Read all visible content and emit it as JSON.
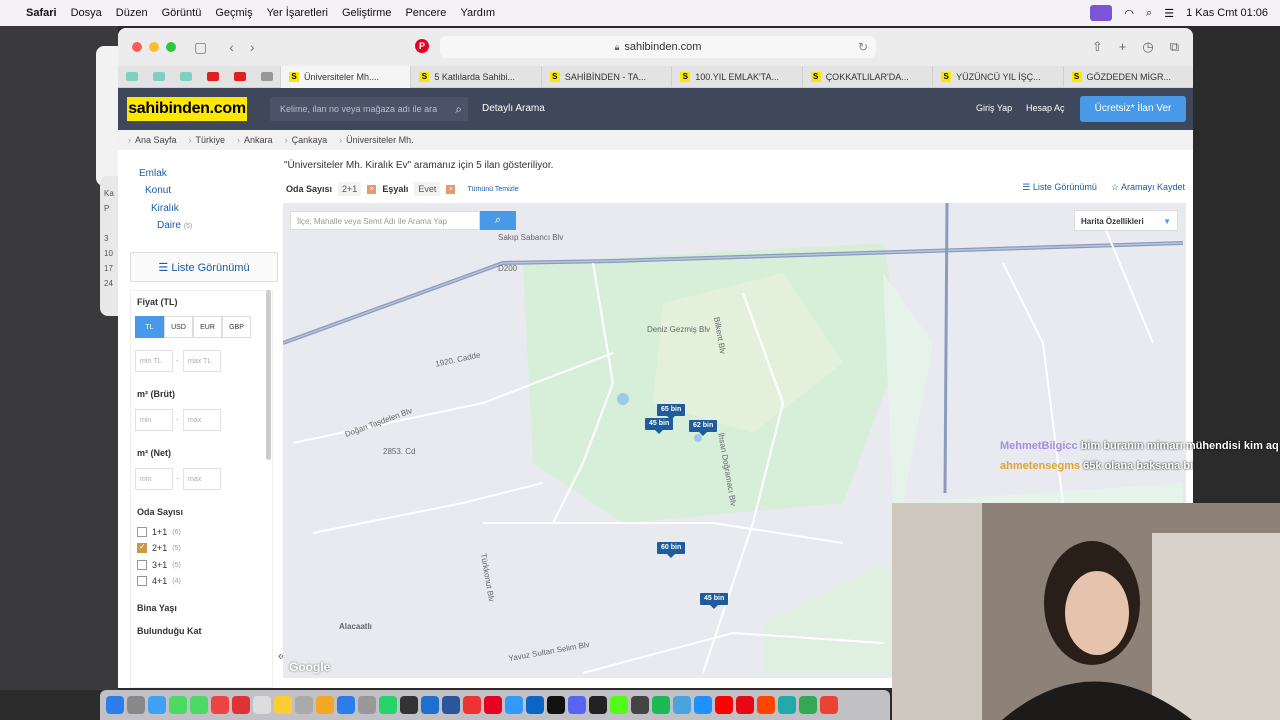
{
  "menubar": {
    "app": "Safari",
    "items": [
      "Dosya",
      "Düzen",
      "Görüntü",
      "Geçmiş",
      "Yer İşaretleri",
      "Geliştirme",
      "Pencere",
      "Yardım"
    ],
    "clock": "1 Kas Cmt  01:06"
  },
  "browser": {
    "url": "sahibinden.com",
    "tabs": [
      "Üniversiteler Mh....",
      "5 Katlılarda Sahibi...",
      "SAHİBİNDEN - TA...",
      "100.YIL EMLAK'TA...",
      "ÇOKKATLILAR'DA...",
      "YÜZÜNCÜ YIL İŞÇ...",
      "GÖZDEDEN MİGR..."
    ]
  },
  "site": {
    "logo": "sahibinden.com",
    "search_placeholder": "Kelime, ilan no veya mağaza adı ile ara",
    "detailed_search": "Detaylı Arama",
    "login": "Giriş Yap",
    "register": "Hesap Aç",
    "cta": "Ücretsiz* İlan Ver"
  },
  "breadcrumb": [
    "Ana Sayfa",
    "Türkiye",
    "Ankara",
    "Çankaya",
    "Üniversiteler Mh."
  ],
  "sidebar": {
    "categories": [
      {
        "label": "Emlak",
        "count": ""
      },
      {
        "label": "Konut",
        "count": ""
      },
      {
        "label": "Kiralık",
        "count": ""
      },
      {
        "label": "Daire",
        "count": "(5)"
      }
    ],
    "list_view": "Liste Görünümü",
    "price_label": "Fiyat (TL)",
    "currencies": [
      "TL",
      "USD",
      "EUR",
      "GBP"
    ],
    "price_min": "min TL",
    "price_max": "max TL",
    "m2_brut": "m² (Brüt)",
    "m2_net": "m² (Net)",
    "min": "min",
    "max": "max",
    "rooms_label": "Oda Sayısı",
    "rooms": [
      {
        "label": "1+1",
        "count": "(6)",
        "checked": false
      },
      {
        "label": "2+1",
        "count": "(5)",
        "checked": true
      },
      {
        "label": "3+1",
        "count": "(5)",
        "checked": false
      },
      {
        "label": "4+1",
        "count": "(4)",
        "checked": false
      }
    ],
    "building_age": "Bina Yaşı",
    "floor": "Bulunduğu Kat"
  },
  "results": {
    "title": "\"Üniversiteler Mh. Kiralık Ev\" aramanız için 5 ilan gösteriliyor.",
    "filter_room_label": "Oda Sayısı",
    "filter_room_value": "2+1",
    "filter_furnished_label": "Eşyalı",
    "filter_furnished_value": "Evet",
    "clear_all": "Tümünü Temizle",
    "list_view": "Liste Görünümü",
    "save_search": "Aramayı Kaydet"
  },
  "map": {
    "search_placeholder": "İlçe, Mahalle veya Semt Adı ile Arama Yap",
    "features": "Harita Özellikleri",
    "pins": [
      "65 bin",
      "45 bin",
      "62 bin",
      "60 bin",
      "45 bin"
    ],
    "streets": [
      "Sakıp Sabancı Blv",
      "Deniz Gezmiş Blv",
      "Bilkent Blv",
      "İhsan Doğramacı Blv",
      "1920. Cadde",
      "Doğan Taşdelen Blv",
      "Alacaatlı",
      "Yavuz Sultan Selim Blv",
      "2853. Cd",
      "Türkkonut Blv",
      "D200"
    ],
    "attribution": "Google"
  },
  "chat": [
    {
      "user": "MehmetBilgicc",
      "text": "bim buranın mimarı mühendisi kim aq"
    },
    {
      "user": "ahmetensegms",
      "text": "65k olana baksana bi"
    }
  ]
}
